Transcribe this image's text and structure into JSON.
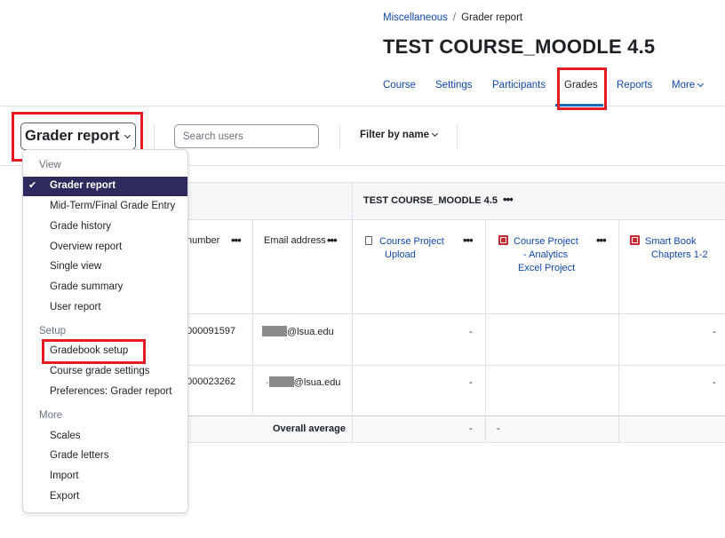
{
  "breadcrumb": {
    "parent": "Miscellaneous",
    "separator": "/",
    "current": "Grader report"
  },
  "course_title": "TEST COURSE_MOODLE 4.5",
  "nav": {
    "course": "Course",
    "settings": "Settings",
    "participants": "Participants",
    "grades": "Grades",
    "reports": "Reports",
    "more": "More",
    "active": "Grades"
  },
  "toolbar": {
    "report_selector": "Grader report",
    "search_placeholder": "Search users",
    "filter_by_name": "Filter by name"
  },
  "dropdown": {
    "view_header": "View",
    "view_items": [
      "Grader report",
      "Mid-Term/Final Grade Entry",
      "Grade history",
      "Overview report",
      "Single view",
      "Grade summary",
      "User report"
    ],
    "selected": "Grader report",
    "setup_header": "Setup",
    "setup_items": [
      "Gradebook setup",
      "Course grade settings",
      "Preferences: Grader report"
    ],
    "more_header": "More",
    "more_items": [
      "Scales",
      "Grade letters",
      "Import",
      "Export"
    ]
  },
  "table": {
    "category_title": "TEST COURSE_MOODLE 4.5",
    "col_id": "number",
    "col_email": "Email address",
    "col_item1_line1": "Course Project",
    "col_item1_line2": "Upload",
    "col_item2_line1": "Course Project",
    "col_item2_line2": "- Analytics",
    "col_item2_line3": "Excel Project",
    "col_item3_line1": "Smart Book",
    "col_item3_line2": "Chapters 1-2",
    "rows": [
      {
        "id": "000091597",
        "email_suffix": "@lsua.edu",
        "item1": "-",
        "item3": "-"
      },
      {
        "id": "000023262",
        "email_suffix": "@lsua.edu",
        "item1": "-",
        "item3": "-"
      }
    ],
    "overall_label": "Overall average",
    "overall_item1": "-",
    "overall_item2": "-"
  },
  "colors": {
    "link": "#0f47ad",
    "selected_bg": "#2f2a5e",
    "highlight": "#e31b23",
    "grade_icon": "#c8272f"
  },
  "icons": [
    "check-icon",
    "chevron-down-icon",
    "more-dots-icon",
    "file-icon",
    "grade-item-icon"
  ]
}
